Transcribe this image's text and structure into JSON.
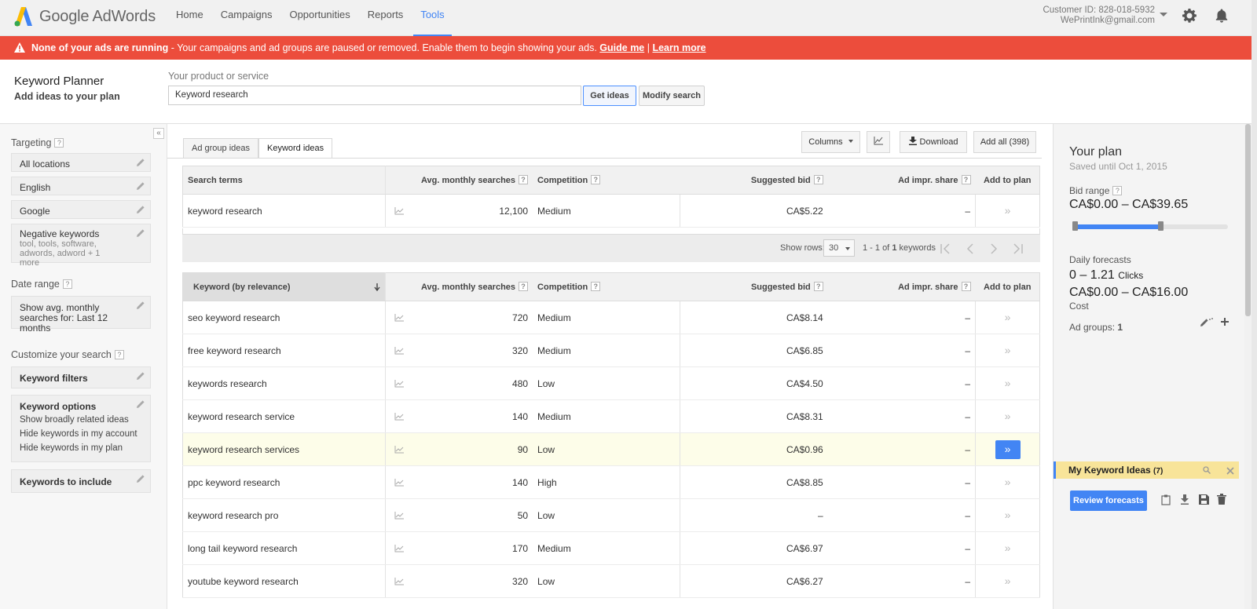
{
  "app": {
    "logo_text": "Google AdWords"
  },
  "nav": {
    "items": [
      "Home",
      "Campaigns",
      "Opportunities",
      "Reports",
      "Tools"
    ],
    "active": "Tools"
  },
  "account": {
    "customer_id": "Customer ID: 828-018-5932",
    "email": "WePrintInk@gmail.com"
  },
  "alert": {
    "bold": "None of your ads are running",
    "text": " - Your campaigns and ad groups are paused or removed. Enable them to begin showing your ads. ",
    "link1": "Guide me",
    "sep": " | ",
    "link2": "Learn more"
  },
  "header": {
    "title": "Keyword Planner",
    "subtitle": "Add ideas to your plan",
    "product_label": "Your product or service",
    "product_value": "Keyword research",
    "get_ideas": "Get ideas",
    "modify": "Modify search"
  },
  "sidebar": {
    "collapse": "«",
    "targeting": "Targeting",
    "targets": [
      "All locations",
      "English",
      "Google"
    ],
    "negative_title": "Negative keywords",
    "negative_list": "tool, tools, software, adwords, adword + 1 more",
    "date_range": "Date range",
    "date_value": "Show avg. monthly searches for: Last 12 months",
    "customize": "Customize your search",
    "keyword_filters": "Keyword filters",
    "keyword_options": "Keyword options",
    "options": [
      "Show broadly related ideas",
      "Hide keywords in my account",
      "Hide keywords in my plan"
    ],
    "keywords_include": "Keywords to include",
    "help": "?"
  },
  "tabs": {
    "ad_group": "Ad group ideas",
    "keyword": "Keyword ideas"
  },
  "toolbar": {
    "columns": "Columns",
    "download": "Download",
    "add_all": "Add all (398)"
  },
  "columns": {
    "search_terms": "Search terms",
    "keyword_relevance": "Keyword (by relevance)",
    "avg": "Avg. monthly searches",
    "competition": "Competition",
    "bid": "Suggested bid",
    "share": "Ad impr. share",
    "add": "Add to plan"
  },
  "search_terms": [
    {
      "kw": "keyword research",
      "avg": "12,100",
      "comp": "Medium",
      "bid": "CA$5.22",
      "share": "–"
    }
  ],
  "pager": {
    "show_rows": "Show rows:",
    "rows": "30",
    "range": "1 - 1 of",
    "count": "1",
    "unit": "keywords"
  },
  "keyword_ideas": [
    {
      "kw": "seo keyword research",
      "avg": "720",
      "comp": "Medium",
      "bid": "CA$8.14",
      "share": "–"
    },
    {
      "kw": "free keyword research",
      "avg": "320",
      "comp": "Medium",
      "bid": "CA$6.85",
      "share": "–"
    },
    {
      "kw": "keywords research",
      "avg": "480",
      "comp": "Low",
      "bid": "CA$4.50",
      "share": "–"
    },
    {
      "kw": "keyword research service",
      "avg": "140",
      "comp": "Medium",
      "bid": "CA$8.31",
      "share": "–"
    },
    {
      "kw": "keyword research services",
      "avg": "90",
      "comp": "Low",
      "bid": "CA$0.96",
      "share": "–"
    },
    {
      "kw": "ppc keyword research",
      "avg": "140",
      "comp": "High",
      "bid": "CA$8.85",
      "share": "–"
    },
    {
      "kw": "keyword research pro",
      "avg": "50",
      "comp": "Low",
      "bid": "–",
      "share": "–"
    },
    {
      "kw": "long tail keyword research",
      "avg": "170",
      "comp": "Medium",
      "bid": "CA$6.97",
      "share": "–"
    },
    {
      "kw": "youtube keyword research",
      "avg": "320",
      "comp": "Low",
      "bid": "CA$6.27",
      "share": "–"
    }
  ],
  "highlight_row": 4,
  "plan": {
    "title": "Your plan",
    "saved": "Saved until Oct 1, 2015",
    "bid_range_label": "Bid range",
    "bid_range": "CA$0.00 – CA$39.65",
    "bid_slider_min_fraction": 0,
    "bid_slider_max_fraction": 0.57,
    "daily": "Daily forecasts",
    "clicks_value": "0 – 1.21",
    "clicks_label": "Clicks",
    "cost_value": "CA$0.00 – CA$16.00",
    "cost_label": "Cost",
    "ad_groups_label": "Ad groups:",
    "ad_groups_count": "1",
    "ad_group_name": "My Keyword Ideas",
    "ad_group_count": "(7)",
    "review": "Review forecasts"
  },
  "colors": {
    "accent": "#4285f4",
    "alert": "#ec4d3c",
    "highlight": "#fdfde9",
    "plan_group": "#f8e499"
  }
}
